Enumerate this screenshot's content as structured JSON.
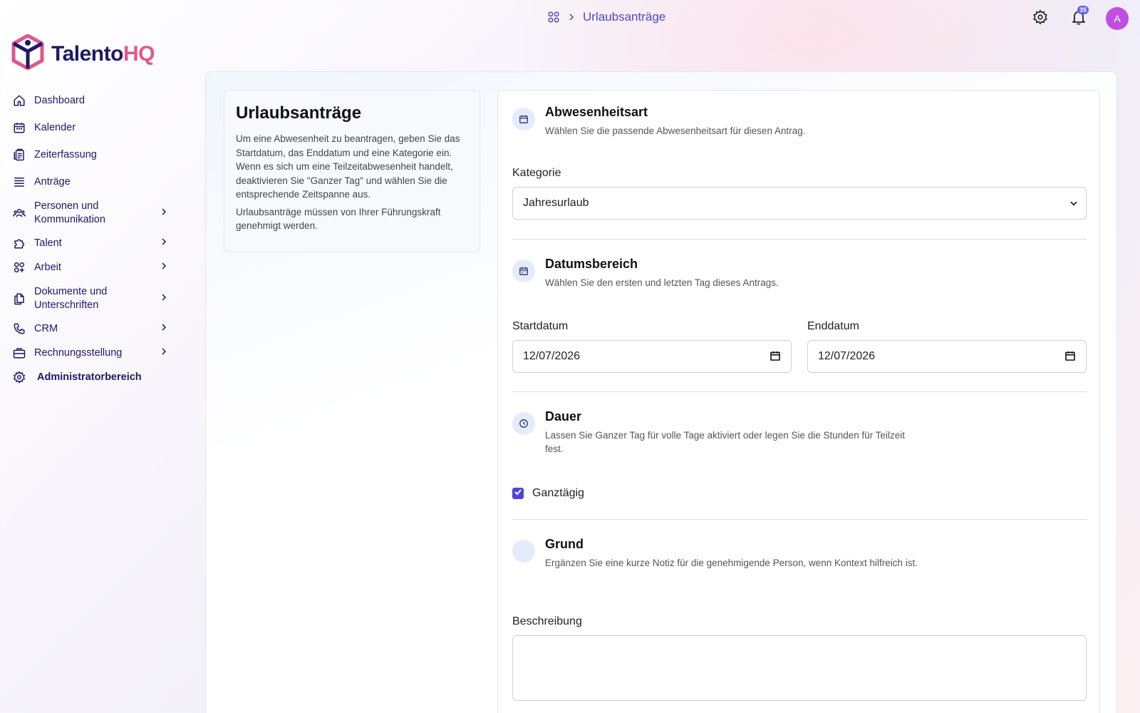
{
  "app": {
    "logo_part1": "Talento",
    "logo_part2": "HQ",
    "brand_colors": {
      "navy": "#1e1a66",
      "pink": "#e0578a",
      "accent": "#4e46d6"
    }
  },
  "topbar": {
    "breadcrumb_label": "Urlaubsanträge",
    "notification_count": "35",
    "avatar_initial": "A"
  },
  "sidebar": {
    "items": [
      {
        "label": "Dashboard",
        "icon": "home-icon"
      },
      {
        "label": "Kalender",
        "icon": "calendar-icon"
      },
      {
        "label": "Zeiterfassung",
        "icon": "clipboard-icon"
      },
      {
        "label": "Anträge",
        "icon": "stack-icon"
      },
      {
        "label": "Personen und Kommunikation",
        "icon": "users-icon"
      },
      {
        "label": "Talent",
        "icon": "puzzle-icon"
      },
      {
        "label": "Arbeit",
        "icon": "apps-icon"
      },
      {
        "label": "Dokumente und Unterschriften",
        "icon": "documents-icon"
      },
      {
        "label": "CRM",
        "icon": "phone-icon"
      },
      {
        "label": "Rechnungsstellung",
        "icon": "briefcase-icon"
      },
      {
        "label": "Administratorbereich",
        "icon": "gear-icon"
      }
    ]
  },
  "info": {
    "title": "Urlaubsanträge",
    "paragraph1": "Um eine Abwesenheit zu beantragen, geben Sie das Startdatum, das Enddatum und eine Kategorie ein. Wenn es sich um eine Teilzeitabwesenheit handelt, deaktivieren Sie \"Ganzer Tag\" und wählen Sie die entsprechende Zeitspanne aus.",
    "paragraph2": "Urlaubsanträge müssen von Ihrer Führungskraft genehmigt werden."
  },
  "form": {
    "absence_type": {
      "title": "Abwesenheitsart",
      "description": "Wählen Sie die passende Abwesenheitsart für diesen Antrag.",
      "category_label": "Kategorie",
      "category_value": "Jahresurlaub"
    },
    "date_range": {
      "title": "Datumsbereich",
      "description": "Wählen Sie den ersten und letzten Tag dieses Antrags.",
      "start_label": "Startdatum",
      "start_value": "12/07/2026",
      "end_label": "Enddatum",
      "end_value": "12/07/2026"
    },
    "duration": {
      "title": "Dauer",
      "description": "Lassen Sie Ganzer Tag für volle Tage aktiviert oder legen Sie die Stunden für Teilzeit fest.",
      "full_day_label": "Ganztägig",
      "full_day_checked": true
    },
    "reason": {
      "title": "Grund",
      "description": "Ergänzen Sie eine kurze Notiz für die genehmigende Person, wenn Kontext hilfreich ist.",
      "description_label": "Beschreibung",
      "description_value": ""
    }
  }
}
